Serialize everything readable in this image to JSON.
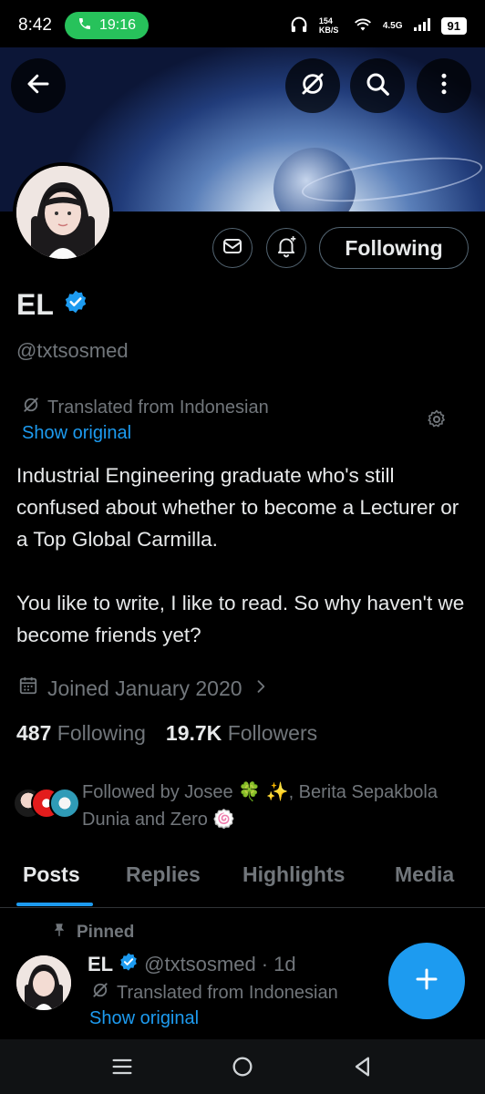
{
  "status_bar": {
    "time": "8:42",
    "call_duration": "19:16",
    "net_speed": "154 KB/S",
    "network": "4.5G",
    "battery": "91"
  },
  "header": {
    "back": "back-arrow-icon",
    "actions": [
      "grok-icon",
      "search-icon",
      "more-icon"
    ]
  },
  "profile": {
    "name": "EL",
    "verified": true,
    "handle": "@txtsosmed",
    "following_button": "Following",
    "translation_note": "Translated from Indonesian",
    "show_original": "Show original",
    "bio_lines": [
      "Industrial Engineering graduate who's still confused about whether to become a Lecturer or a Top Global Carmilla.",
      "You like to write, I like to read. So why haven't we become friends yet?"
    ],
    "joined": "Joined January 2020",
    "following_count": "487",
    "following_label": "Following",
    "followers_count": "19.7K",
    "followers_label": "Followers",
    "followed_by": "Followed by Josee 🍀 ✨, Berita Sepakbola Dunia and Zero 🍥"
  },
  "tabs": [
    "Posts",
    "Replies",
    "Highlights",
    "Media"
  ],
  "active_tab": "Posts",
  "pinned_post": {
    "pinned_label": "Pinned",
    "name": "EL",
    "handle": "@txtsosmed",
    "age": "· 1d",
    "translation_note": "Translated from Indonesian",
    "show_original": "Show original"
  },
  "colors": {
    "accent": "#1d9bf0",
    "background": "#000000",
    "muted": "#71767b",
    "call_pill": "#27c25b"
  }
}
